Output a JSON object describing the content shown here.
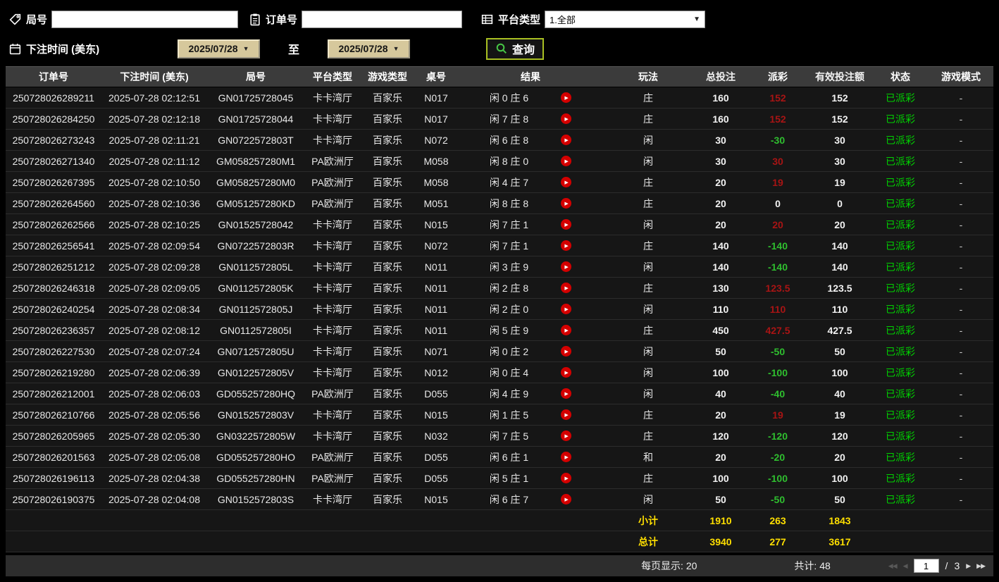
{
  "filters": {
    "game_no": {
      "label": "局号",
      "value": ""
    },
    "order_no": {
      "label": "订单号",
      "value": ""
    },
    "platform": {
      "label": "平台类型",
      "value": "1.全部"
    },
    "bet_time_label": "下注时间 (美东)",
    "date_from": "2025/07/28",
    "date_to": "2025/07/28",
    "to_label": "至",
    "query_label": "查询"
  },
  "icons": {
    "caret_down": "▼",
    "play": "▶",
    "first": "◀◀",
    "prev": "◀",
    "next": "▶",
    "last": "▶▶"
  },
  "table": {
    "columns": [
      "订单号",
      "下注时间 (美东)",
      "局号",
      "平台类型",
      "游戏类型",
      "桌号",
      "结果",
      "玩法",
      "总投注",
      "派彩",
      "有效投注额",
      "状态",
      "游戏模式"
    ],
    "rows": [
      {
        "order": "250728026289211",
        "time": "2025-07-28 02:12:51",
        "game": "GN01725728045",
        "platform": "卡卡湾厅",
        "game_type": "百家乐",
        "table_no": "N017",
        "result": "闲 0 庄 6",
        "play": "庄",
        "bet": "160",
        "payout": "152",
        "payout_class": "win",
        "valid": "152",
        "status": "已派彩",
        "mode": "-"
      },
      {
        "order": "250728026284250",
        "time": "2025-07-28 02:12:18",
        "game": "GN01725728044",
        "platform": "卡卡湾厅",
        "game_type": "百家乐",
        "table_no": "N017",
        "result": "闲 7 庄 8",
        "play": "庄",
        "bet": "160",
        "payout": "152",
        "payout_class": "win",
        "valid": "152",
        "status": "已派彩",
        "mode": "-"
      },
      {
        "order": "250728026273243",
        "time": "2025-07-28 02:11:21",
        "game": "GN0722572803T",
        "platform": "卡卡湾厅",
        "game_type": "百家乐",
        "table_no": "N072",
        "result": "闲 6 庄 8",
        "play": "闲",
        "bet": "30",
        "payout": "-30",
        "payout_class": "loss",
        "valid": "30",
        "status": "已派彩",
        "mode": "-"
      },
      {
        "order": "250728026271340",
        "time": "2025-07-28 02:11:12",
        "game": "GM058257280M1",
        "platform": "PA欧洲厅",
        "game_type": "百家乐",
        "table_no": "M058",
        "result": "闲 8 庄 0",
        "play": "闲",
        "bet": "30",
        "payout": "30",
        "payout_class": "win",
        "valid": "30",
        "status": "已派彩",
        "mode": "-"
      },
      {
        "order": "250728026267395",
        "time": "2025-07-28 02:10:50",
        "game": "GM058257280M0",
        "platform": "PA欧洲厅",
        "game_type": "百家乐",
        "table_no": "M058",
        "result": "闲 4 庄 7",
        "play": "庄",
        "bet": "20",
        "payout": "19",
        "payout_class": "win",
        "valid": "19",
        "status": "已派彩",
        "mode": "-"
      },
      {
        "order": "250728026264560",
        "time": "2025-07-28 02:10:36",
        "game": "GM051257280KD",
        "platform": "PA欧洲厅",
        "game_type": "百家乐",
        "table_no": "M051",
        "result": "闲 8 庄 8",
        "play": "庄",
        "bet": "20",
        "payout": "0",
        "payout_class": "zero",
        "valid": "0",
        "status": "已派彩",
        "mode": "-"
      },
      {
        "order": "250728026262566",
        "time": "2025-07-28 02:10:25",
        "game": "GN01525728042",
        "platform": "卡卡湾厅",
        "game_type": "百家乐",
        "table_no": "N015",
        "result": "闲 7 庄 1",
        "play": "闲",
        "bet": "20",
        "payout": "20",
        "payout_class": "win",
        "valid": "20",
        "status": "已派彩",
        "mode": "-"
      },
      {
        "order": "250728026256541",
        "time": "2025-07-28 02:09:54",
        "game": "GN0722572803R",
        "platform": "卡卡湾厅",
        "game_type": "百家乐",
        "table_no": "N072",
        "result": "闲 7 庄 1",
        "play": "庄",
        "bet": "140",
        "payout": "-140",
        "payout_class": "loss",
        "valid": "140",
        "status": "已派彩",
        "mode": "-"
      },
      {
        "order": "250728026251212",
        "time": "2025-07-28 02:09:28",
        "game": "GN0112572805L",
        "platform": "卡卡湾厅",
        "game_type": "百家乐",
        "table_no": "N011",
        "result": "闲 3 庄 9",
        "play": "闲",
        "bet": "140",
        "payout": "-140",
        "payout_class": "loss",
        "valid": "140",
        "status": "已派彩",
        "mode": "-"
      },
      {
        "order": "250728026246318",
        "time": "2025-07-28 02:09:05",
        "game": "GN0112572805K",
        "platform": "卡卡湾厅",
        "game_type": "百家乐",
        "table_no": "N011",
        "result": "闲 2 庄 8",
        "play": "庄",
        "bet": "130",
        "payout": "123.5",
        "payout_class": "win",
        "valid": "123.5",
        "status": "已派彩",
        "mode": "-"
      },
      {
        "order": "250728026240254",
        "time": "2025-07-28 02:08:34",
        "game": "GN0112572805J",
        "platform": "卡卡湾厅",
        "game_type": "百家乐",
        "table_no": "N011",
        "result": "闲 2 庄 0",
        "play": "闲",
        "bet": "110",
        "payout": "110",
        "payout_class": "win",
        "valid": "110",
        "status": "已派彩",
        "mode": "-"
      },
      {
        "order": "250728026236357",
        "time": "2025-07-28 02:08:12",
        "game": "GN0112572805I",
        "platform": "卡卡湾厅",
        "game_type": "百家乐",
        "table_no": "N011",
        "result": "闲 5 庄 9",
        "play": "庄",
        "bet": "450",
        "payout": "427.5",
        "payout_class": "win",
        "valid": "427.5",
        "status": "已派彩",
        "mode": "-"
      },
      {
        "order": "250728026227530",
        "time": "2025-07-28 02:07:24",
        "game": "GN0712572805U",
        "platform": "卡卡湾厅",
        "game_type": "百家乐",
        "table_no": "N071",
        "result": "闲 0 庄 2",
        "play": "闲",
        "bet": "50",
        "payout": "-50",
        "payout_class": "loss",
        "valid": "50",
        "status": "已派彩",
        "mode": "-"
      },
      {
        "order": "250728026219280",
        "time": "2025-07-28 02:06:39",
        "game": "GN0122572805V",
        "platform": "卡卡湾厅",
        "game_type": "百家乐",
        "table_no": "N012",
        "result": "闲 0 庄 4",
        "play": "闲",
        "bet": "100",
        "payout": "-100",
        "payout_class": "loss",
        "valid": "100",
        "status": "已派彩",
        "mode": "-"
      },
      {
        "order": "250728026212001",
        "time": "2025-07-28 02:06:03",
        "game": "GD055257280HQ",
        "platform": "PA欧洲厅",
        "game_type": "百家乐",
        "table_no": "D055",
        "result": "闲 4 庄 9",
        "play": "闲",
        "bet": "40",
        "payout": "-40",
        "payout_class": "loss",
        "valid": "40",
        "status": "已派彩",
        "mode": "-"
      },
      {
        "order": "250728026210766",
        "time": "2025-07-28 02:05:56",
        "game": "GN0152572803V",
        "platform": "卡卡湾厅",
        "game_type": "百家乐",
        "table_no": "N015",
        "result": "闲 1 庄 5",
        "play": "庄",
        "bet": "20",
        "payout": "19",
        "payout_class": "win",
        "valid": "19",
        "status": "已派彩",
        "mode": "-"
      },
      {
        "order": "250728026205965",
        "time": "2025-07-28 02:05:30",
        "game": "GN0322572805W",
        "platform": "卡卡湾厅",
        "game_type": "百家乐",
        "table_no": "N032",
        "result": "闲 7 庄 5",
        "play": "庄",
        "bet": "120",
        "payout": "-120",
        "payout_class": "loss",
        "valid": "120",
        "status": "已派彩",
        "mode": "-"
      },
      {
        "order": "250728026201563",
        "time": "2025-07-28 02:05:08",
        "game": "GD055257280HO",
        "platform": "PA欧洲厅",
        "game_type": "百家乐",
        "table_no": "D055",
        "result": "闲 6 庄 1",
        "play": "和",
        "bet": "20",
        "payout": "-20",
        "payout_class": "loss",
        "valid": "20",
        "status": "已派彩",
        "mode": "-"
      },
      {
        "order": "250728026196113",
        "time": "2025-07-28 02:04:38",
        "game": "GD055257280HN",
        "platform": "PA欧洲厅",
        "game_type": "百家乐",
        "table_no": "D055",
        "result": "闲 5 庄 1",
        "play": "庄",
        "bet": "100",
        "payout": "-100",
        "payout_class": "loss",
        "valid": "100",
        "status": "已派彩",
        "mode": "-"
      },
      {
        "order": "250728026190375",
        "time": "2025-07-28 02:04:08",
        "game": "GN0152572803S",
        "platform": "卡卡湾厅",
        "game_type": "百家乐",
        "table_no": "N015",
        "result": "闲 6 庄 7",
        "play": "闲",
        "bet": "50",
        "payout": "-50",
        "payout_class": "loss",
        "valid": "50",
        "status": "已派彩",
        "mode": "-"
      }
    ],
    "subtotal": {
      "label": "小计",
      "bet": "1910",
      "payout": "263",
      "valid": "1843"
    },
    "total": {
      "label": "总计",
      "bet": "3940",
      "payout": "277",
      "valid": "3617"
    }
  },
  "footer": {
    "per_page": "每页显示: 20",
    "total_count": "共计: 48",
    "page": "1",
    "separator": "/",
    "total_pages": "3"
  }
}
